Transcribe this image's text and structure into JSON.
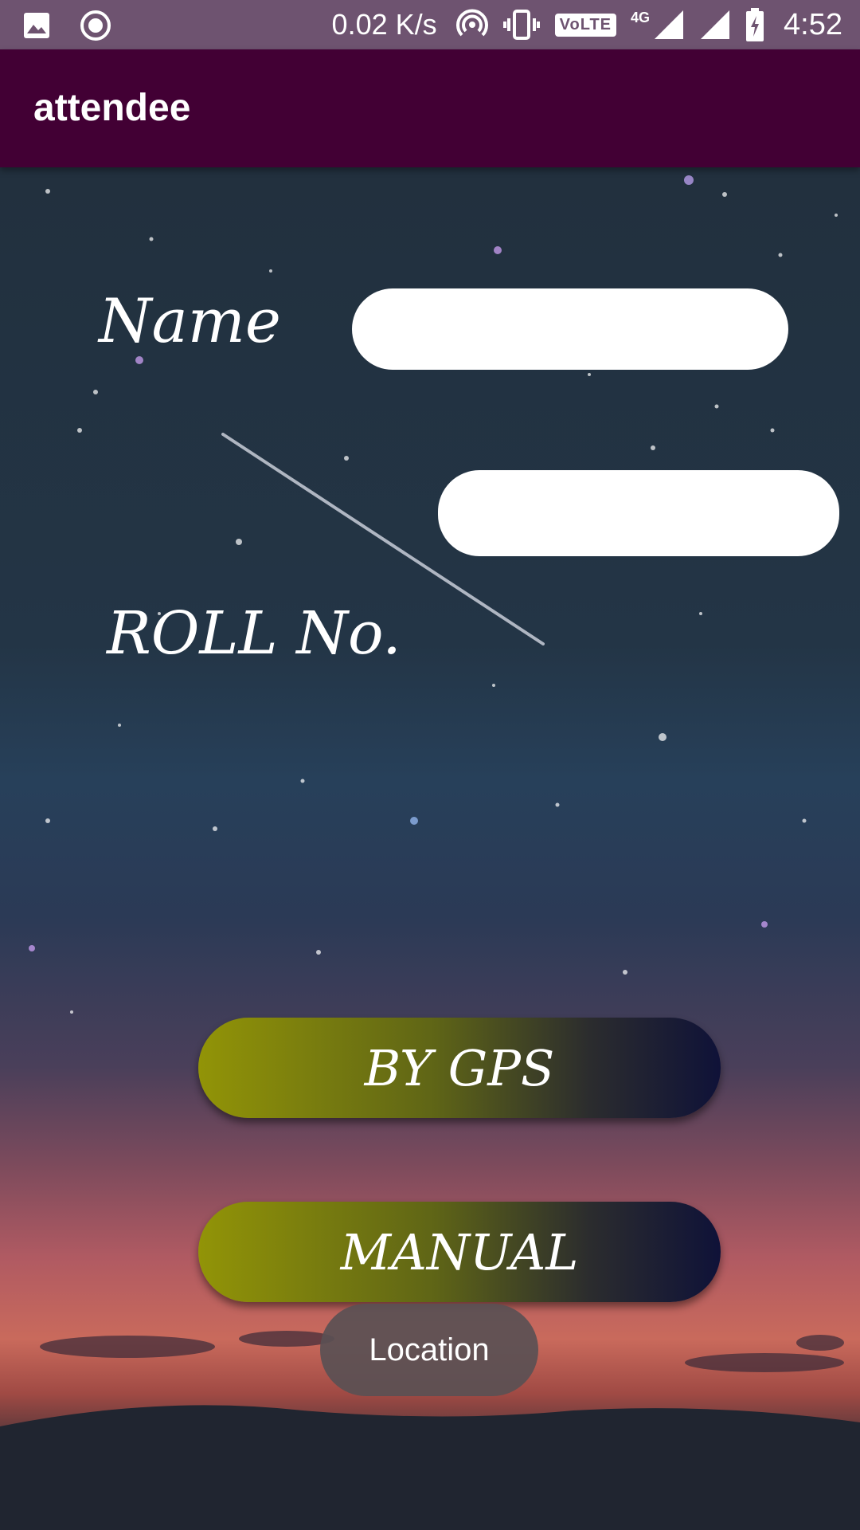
{
  "status_bar": {
    "network_speed": "0.02 K/s",
    "volte": "VoLTE",
    "network_type": "4G",
    "time": "4:52",
    "icons": [
      "image-icon",
      "record-icon",
      "hotspot-icon",
      "vibrate-icon",
      "signal-icon",
      "battery-charging-icon"
    ]
  },
  "app_bar": {
    "title": "attendee",
    "color": "#420034"
  },
  "form": {
    "name_label": "Name",
    "name_value": "",
    "roll_label": "ROLL No.",
    "roll_value": ""
  },
  "buttons": {
    "gps_label": "BY GPS",
    "manual_label": "MANUAL"
  },
  "toast": {
    "text": "Location"
  }
}
